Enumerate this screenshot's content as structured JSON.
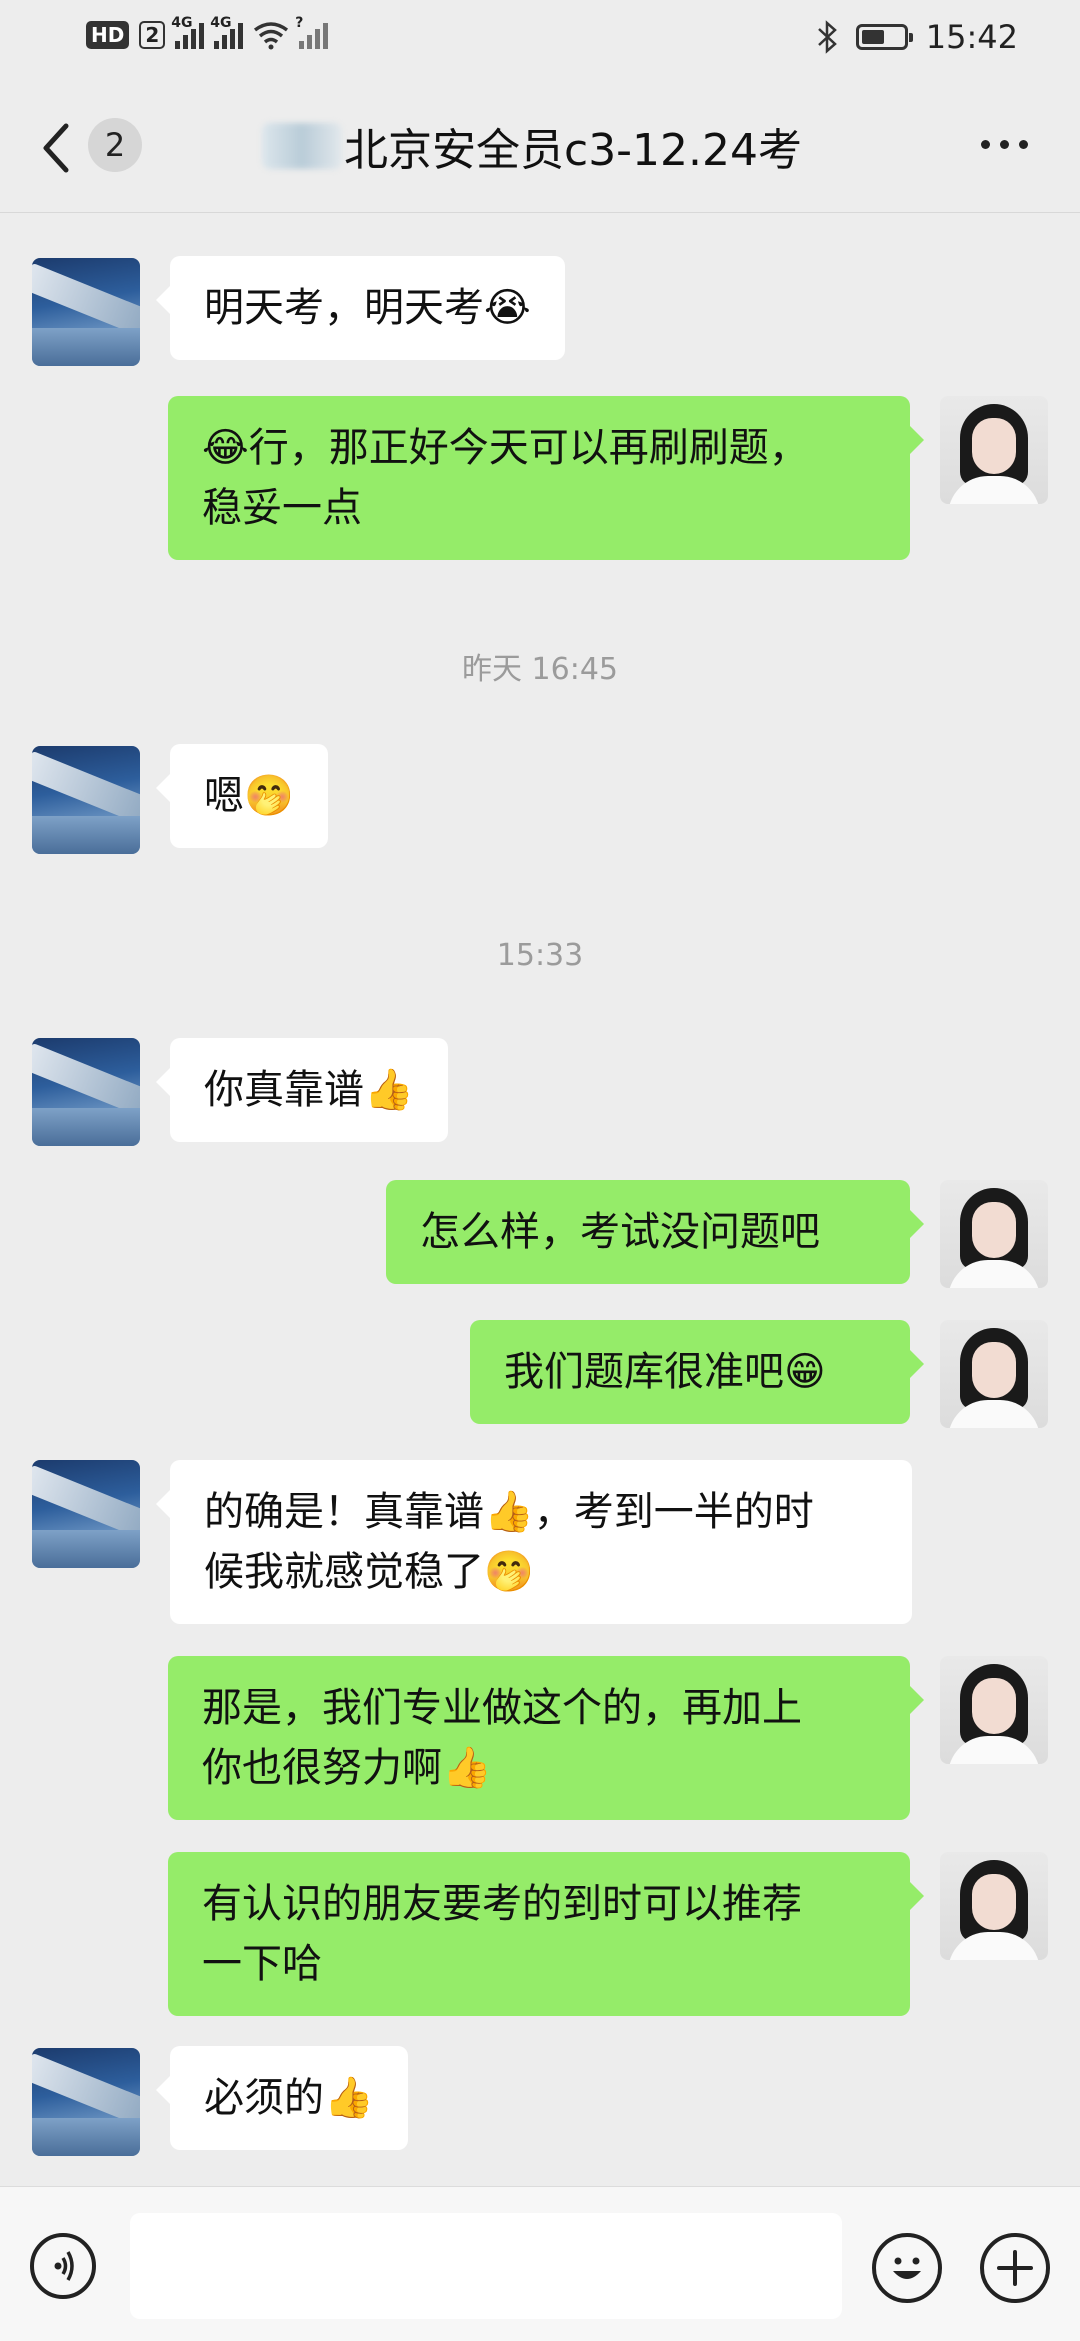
{
  "status_bar": {
    "hd_label": "HD",
    "sim_label": "2",
    "net1": "4G",
    "net2": "4G",
    "net3": "?",
    "time": "15:42",
    "battery_level": 0.55
  },
  "header": {
    "unread_count": "2",
    "title": "北京安全员c3-12.24考"
  },
  "messages": [
    {
      "side": "in",
      "text": "明天考，明天考😭"
    },
    {
      "side": "out",
      "text": "😂行，那正好今天可以再刷刷题，",
      "text2": "稳妥一点"
    },
    {
      "side": "time",
      "text": "昨天 16:45"
    },
    {
      "side": "in",
      "text": "嗯🤭"
    },
    {
      "side": "time",
      "text": "15:33"
    },
    {
      "side": "in",
      "text": "你真靠谱👍"
    },
    {
      "side": "out",
      "text": "怎么样，考试没问题吧"
    },
    {
      "side": "out",
      "text": "我们题库很准吧😁"
    },
    {
      "side": "in",
      "text": "的确是！真靠谱👍，考到一半的时",
      "text2": "候我就感觉稳了🤭"
    },
    {
      "side": "out",
      "text": "那是，我们专业做这个的，再加上",
      "text2": "你也很努力啊👍"
    },
    {
      "side": "out",
      "text": "有认识的朋友要考的到时可以推荐",
      "text2": "一下哈"
    },
    {
      "side": "in",
      "text": "必须的👍"
    }
  ],
  "icons": {
    "back": "chevron-left-icon",
    "more": "more-dots-icon",
    "voice": "voice-icon",
    "emoji": "emoji-icon",
    "plus": "plus-icon"
  },
  "colors": {
    "background": "#ededed",
    "outgoing_bubble": "#95ec69",
    "incoming_bubble": "#ffffff"
  }
}
